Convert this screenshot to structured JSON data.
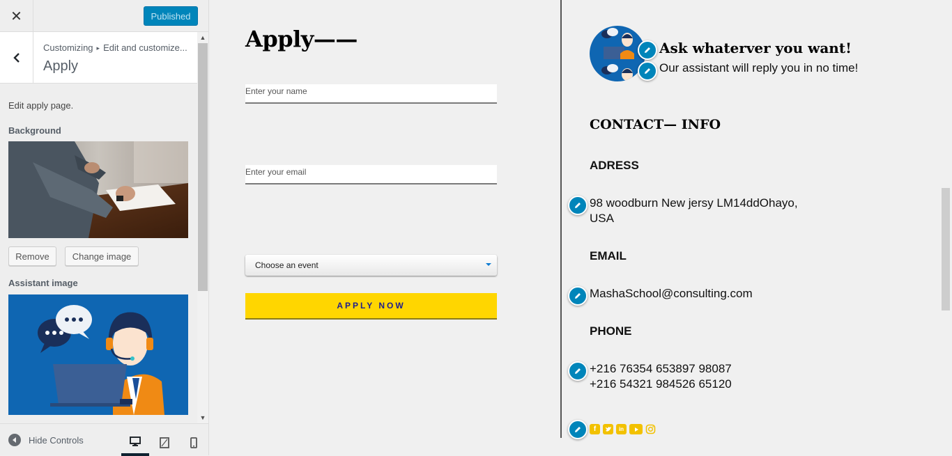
{
  "header": {
    "close_icon": "close-icon",
    "publish_label": "Published"
  },
  "section": {
    "breadcrumb": [
      "Customizing",
      "Edit and customize..."
    ],
    "title": "Apply",
    "description": "Edit apply page."
  },
  "background": {
    "label": "Background",
    "remove_label": "Remove",
    "change_label": "Change image"
  },
  "assistant": {
    "label": "Assistant image"
  },
  "footer": {
    "hide_controls_label": "Hide Controls",
    "devices": [
      "desktop-icon",
      "tablet-icon",
      "mobile-icon"
    ],
    "active_device": "desktop"
  },
  "form": {
    "title": "Apply——",
    "name_placeholder": "Enter your name",
    "email_placeholder": "Enter your email",
    "event_select": "Choose an event",
    "apply_button": "APPLY NOW"
  },
  "assistant_box": {
    "title": "Ask whaterver you want!",
    "subtitle": "Our assistant will reply you in no time!"
  },
  "contact": {
    "heading": "CONTACT— INFO",
    "address_label": "ADRESS",
    "address_line1": "98 woodburn New jersy LM14ddOhayo,",
    "address_line2": "USA",
    "email_label": "EMAIL",
    "email": "MashaSchool@consulting.com",
    "phone_label": "PHONE",
    "phone1": "+216 76354 653897 98087",
    "phone2": "+216 54321 984526 65120",
    "social_icons": [
      "facebook-icon",
      "twitter-icon",
      "linkedin-icon",
      "youtube-icon",
      "instagram-icon"
    ]
  },
  "colors": {
    "primary": "#0085ba",
    "cta": "#ffd600",
    "social": "#f2c100",
    "assistant_bg": "#0f66b2"
  }
}
